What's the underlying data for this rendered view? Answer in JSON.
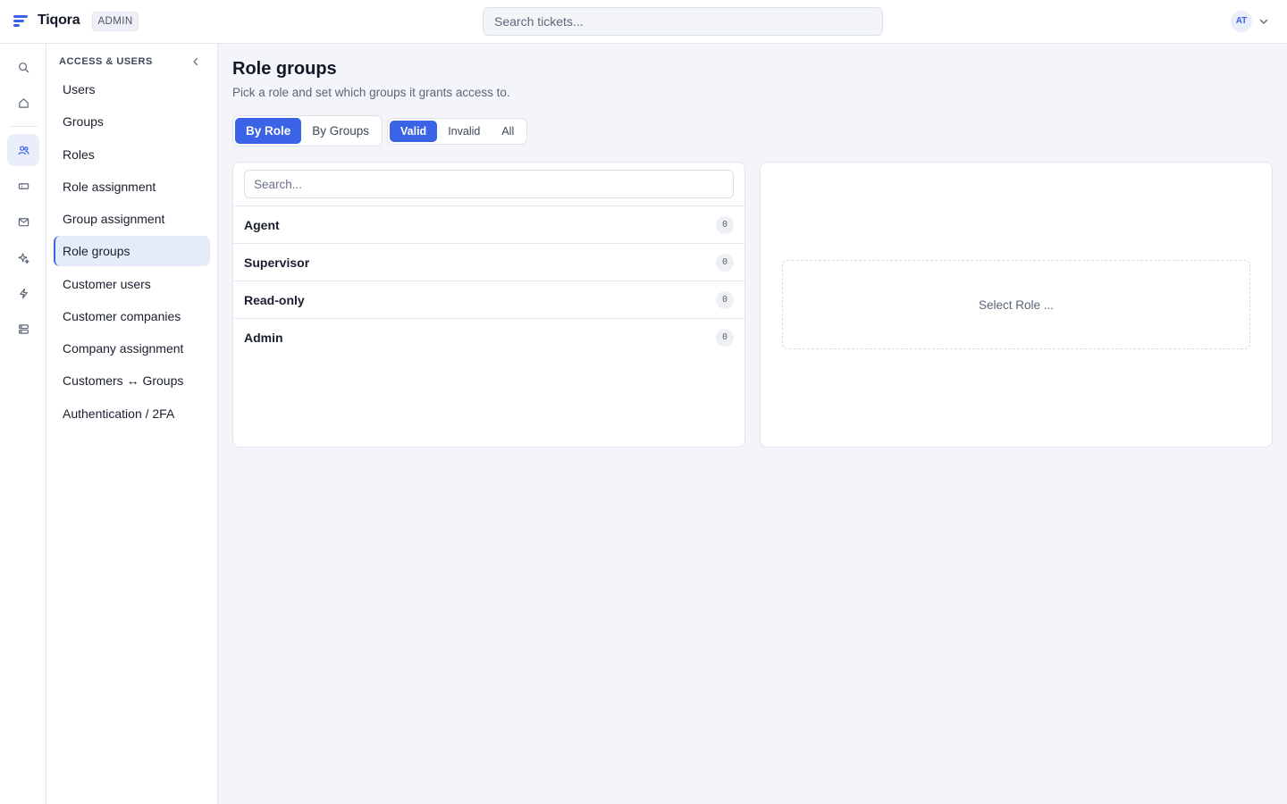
{
  "header": {
    "brand": "Tiqora",
    "badge": "ADMIN",
    "search_placeholder": "Search tickets...",
    "avatar_initials": "AT"
  },
  "rail": {
    "icons": [
      "search-icon",
      "home-icon",
      "users-icon",
      "ticket-icon",
      "mail-icon",
      "sparkles-icon",
      "bolt-icon",
      "server-icon"
    ],
    "active": "users-icon"
  },
  "subnav": {
    "title": "ACCESS & USERS",
    "items": [
      {
        "label": "Users"
      },
      {
        "label": "Groups"
      },
      {
        "label": "Roles"
      },
      {
        "label": "Role assignment"
      },
      {
        "label": "Group assignment"
      },
      {
        "label": "Role groups",
        "active": true
      },
      {
        "label": "Customer users"
      },
      {
        "label": "Customer companies"
      },
      {
        "label": "Company assignment"
      },
      {
        "label": "Customers ↔ Groups"
      },
      {
        "label": "Authentication / 2FA"
      }
    ]
  },
  "main": {
    "title": "Role groups",
    "subtitle": "Pick a role and set which groups it grants access to.",
    "view_toggle": {
      "options": [
        "By Role",
        "By Groups"
      ],
      "selected": "By Role"
    },
    "filter_toggle": {
      "options": [
        "Valid",
        "Invalid",
        "All"
      ],
      "selected": "Valid"
    },
    "list_search_placeholder": "Search...",
    "roles": [
      {
        "name": "Agent",
        "count": "0"
      },
      {
        "name": "Supervisor",
        "count": "0"
      },
      {
        "name": "Read-only",
        "count": "0"
      },
      {
        "name": "Admin",
        "count": "0"
      }
    ],
    "empty_state": "Select Role ..."
  },
  "colors": {
    "accent": "#3b63e6",
    "background": "#f3f5fa",
    "surface": "#ffffff",
    "border": "#e4e7ee"
  }
}
